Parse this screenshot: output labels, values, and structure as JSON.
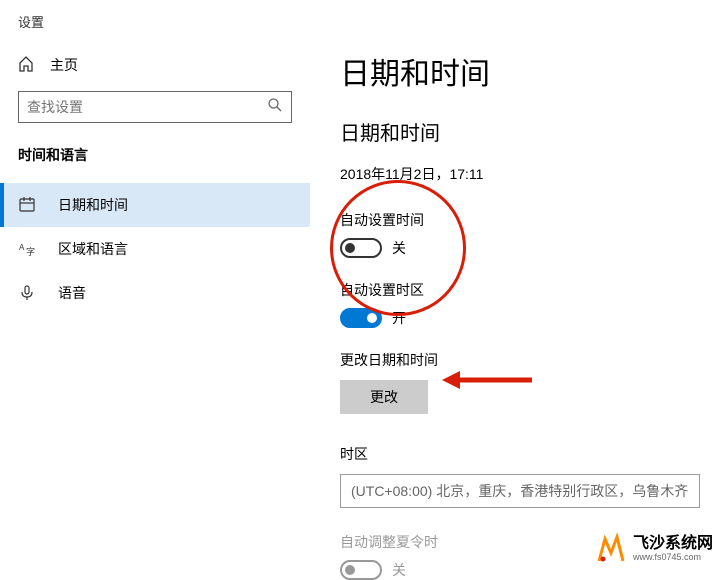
{
  "window": {
    "title": "设置"
  },
  "sidebar": {
    "home": "主页",
    "search_placeholder": "查找设置",
    "section": "时间和语言",
    "items": [
      {
        "label": "日期和时间"
      },
      {
        "label": "区域和语言"
      },
      {
        "label": "语音"
      }
    ]
  },
  "main": {
    "heading": "日期和时间",
    "subheading": "日期和时间",
    "datetime": "2018年11月2日，17:11",
    "auto_time": {
      "label": "自动设置时间",
      "state": "关"
    },
    "auto_tz": {
      "label": "自动设置时区",
      "state": "开"
    },
    "change": {
      "label": "更改日期和时间",
      "button": "更改"
    },
    "timezone": {
      "label": "时区",
      "value": "(UTC+08:00) 北京，重庆，香港特别行政区，乌鲁木齐"
    },
    "dst": {
      "label": "自动调整夏令时",
      "state": "关"
    }
  },
  "watermark": {
    "title": "飞沙系统网",
    "url": "www.fs0745.com"
  }
}
